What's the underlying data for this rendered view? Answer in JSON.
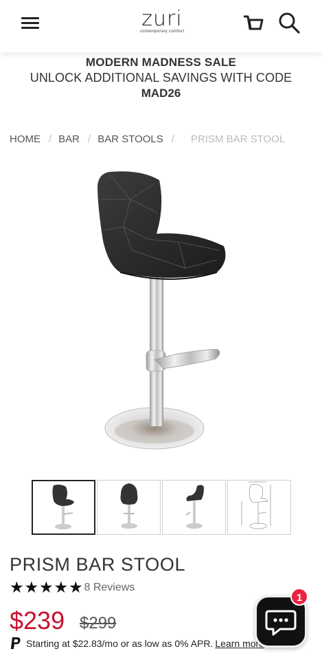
{
  "header": {
    "logo_word": "zuri",
    "logo_tagline": "contemporary comfort"
  },
  "promo": {
    "title": "MODERN MADNESS SALE",
    "line": "UNLOCK ADDITIONAL SAVINGS WITH CODE",
    "code": "MAD26"
  },
  "breadcrumb": {
    "items": [
      "HOME",
      "BAR",
      "BAR STOOLS"
    ],
    "separator": "/",
    "current": "PRISM BAR STOOL"
  },
  "product": {
    "title": "PRISM BAR STOOL",
    "rating_stars": 5,
    "reviews_label": "8 Reviews",
    "price": "$239",
    "compare_price": "$299",
    "financing_text": "Starting at $22.83/mo or as low as 0% APR.",
    "financing_link": "Learn more"
  },
  "gallery": {
    "thumbnails": [
      "front-view",
      "front-view-angle",
      "side-view",
      "dimensions-diagram"
    ],
    "active_index": 0
  },
  "chat": {
    "badge_count": "1"
  },
  "colors": {
    "price": "#c8102e",
    "badge": "#e8233f",
    "text": "#333333"
  },
  "icons": [
    "menu-icon",
    "cart-icon",
    "search-icon",
    "star-icon",
    "paypal-icon",
    "chat-icon"
  ]
}
